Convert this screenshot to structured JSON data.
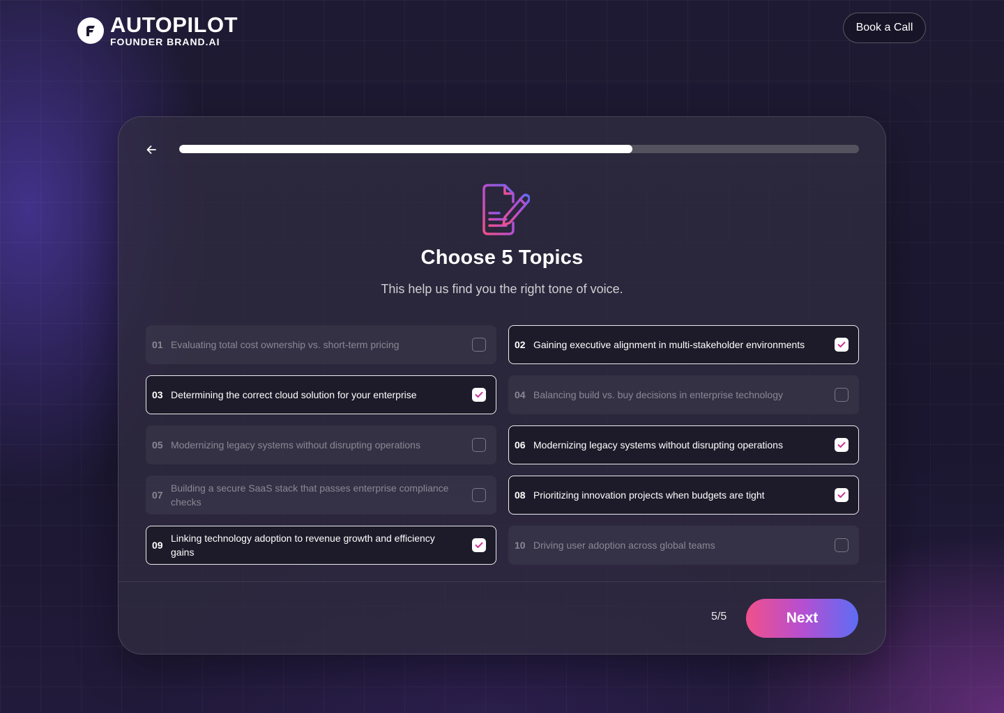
{
  "header": {
    "logo_title": "AUTOPILOT",
    "logo_subtitle": "FOUNDER BRAND.AI",
    "book_call_label": "Book a Call"
  },
  "progress": {
    "value": 0.667
  },
  "step": {
    "title": "Choose 5 Topics",
    "subtitle": "This help us find you the right tone of voice."
  },
  "topics": [
    {
      "num": "01",
      "label": "Evaluating total cost ownership vs. short-term pricing",
      "selected": false
    },
    {
      "num": "02",
      "label": "Gaining executive alignment in multi-stakeholder environments",
      "selected": true
    },
    {
      "num": "03",
      "label": "Determining the correct cloud solution for your enterprise",
      "selected": true
    },
    {
      "num": "04",
      "label": "Balancing build vs. buy decisions in enterprise technology",
      "selected": false
    },
    {
      "num": "05",
      "label": "Modernizing legacy systems without disrupting operations",
      "selected": false
    },
    {
      "num": "06",
      "label": "Modernizing legacy systems without disrupting operations",
      "selected": true
    },
    {
      "num": "07",
      "label": "Building a secure SaaS stack that passes enterprise compliance checks",
      "selected": false
    },
    {
      "num": "08",
      "label": "Prioritizing innovation projects when budgets are tight",
      "selected": true
    },
    {
      "num": "09",
      "label": "Linking technology adoption to revenue growth and efficiency gains",
      "selected": true
    },
    {
      "num": "10",
      "label": "Driving user adoption across global teams",
      "selected": false
    }
  ],
  "footer": {
    "selection_count": "5/5",
    "next_label": "Next"
  },
  "colors": {
    "accent_pink": "#f0508a",
    "accent_purple": "#b64fd0",
    "accent_blue": "#5d6df5",
    "check": "#c8348f"
  },
  "icons": [
    "logo-mark-icon",
    "back-arrow-icon",
    "document-edit-icon",
    "check-icon"
  ]
}
